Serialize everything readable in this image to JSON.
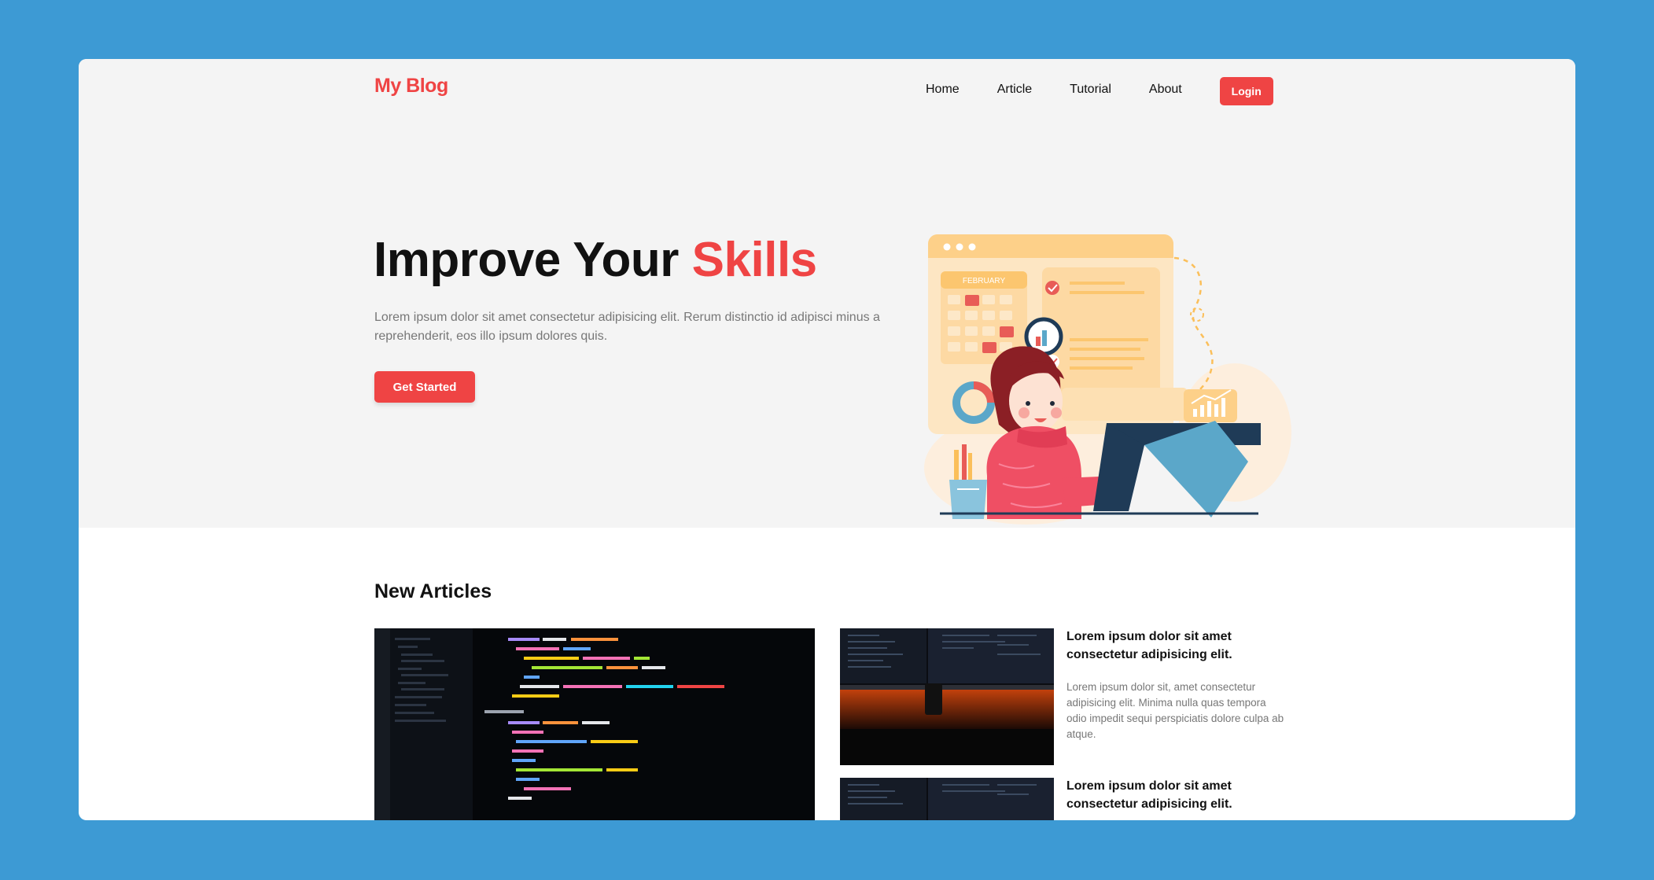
{
  "brand": {
    "name": "My Blog",
    "accent_color": "#ef4444"
  },
  "nav": {
    "links": [
      "Home",
      "Article",
      "Tutorial",
      "About"
    ],
    "login_label": "Login"
  },
  "hero": {
    "title_main": "Improve Your ",
    "title_accent": "Skills",
    "description": "Lorem ipsum dolor sit amet consectetur adipisicing elit. Rerum distinctio id adipisci minus a reprehenderit, eos illo ipsum dolores quis.",
    "cta_label": "Get Started",
    "illustration": {
      "calendar_month": "FEBRUARY",
      "icons": [
        "calendar-icon",
        "magnifier-icon",
        "check-icon",
        "donut-chart-icon",
        "bar-chart-icon",
        "pencil-cup-icon",
        "monitor-icon"
      ]
    }
  },
  "articles": {
    "section_title": "New Articles",
    "featured_image": "code-editor-screenshot",
    "side": [
      {
        "title": "Lorem ipsum dolor sit amet consectetur adipisicing elit.",
        "excerpt": "Lorem ipsum dolor sit, amet consectetur adipisicing elit. Minima nulla quas tempora odio impedit sequi perspiciatis dolore culpa ab atque.",
        "image": "monitors-screenshot"
      },
      {
        "title": "Lorem ipsum dolor sit amet consectetur adipisicing elit.",
        "image": "monitors-screenshot"
      }
    ]
  },
  "colors": {
    "page_bg": "#3d9ad4",
    "hero_bg": "#f4f4f4",
    "accent": "#ef4444"
  }
}
